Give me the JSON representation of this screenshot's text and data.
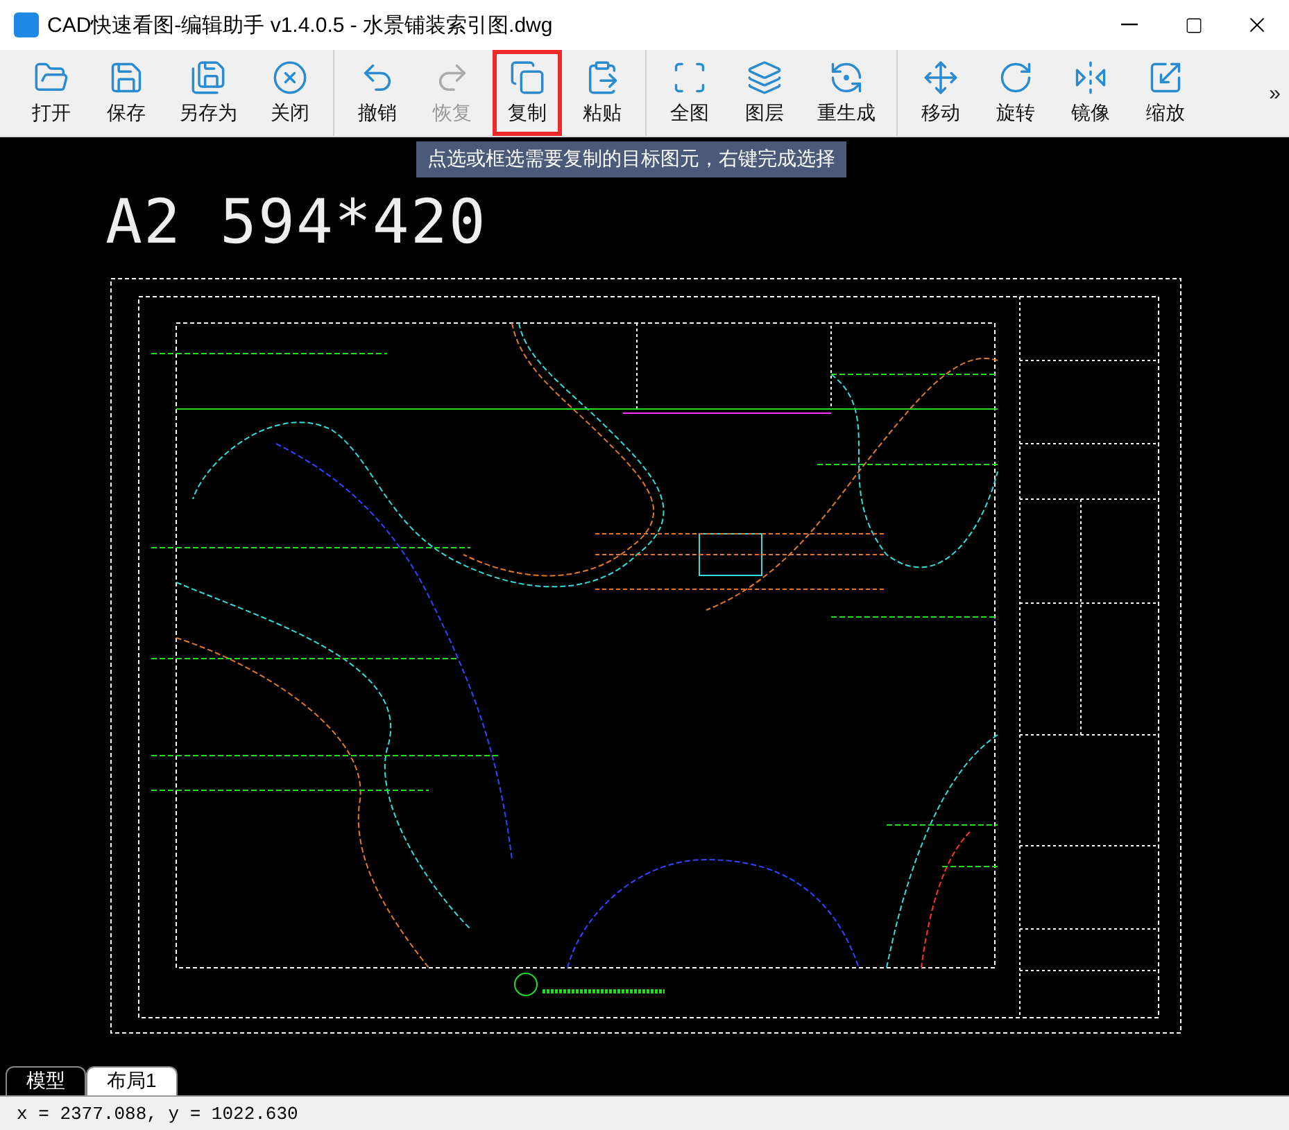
{
  "window": {
    "title": "CAD快速看图-编辑助手 v1.4.0.5 - 水景铺装索引图.dwg"
  },
  "toolbar": {
    "groups": [
      [
        {
          "label": "打开",
          "disabled": false,
          "highlighted": false
        },
        {
          "label": "保存",
          "disabled": false,
          "highlighted": false
        },
        {
          "label": "另存为",
          "disabled": false,
          "highlighted": false
        },
        {
          "label": "关闭",
          "disabled": false,
          "highlighted": false
        }
      ],
      [
        {
          "label": "撤销",
          "disabled": false,
          "highlighted": false
        },
        {
          "label": "恢复",
          "disabled": true,
          "highlighted": false
        },
        {
          "label": "复制",
          "disabled": false,
          "highlighted": true
        },
        {
          "label": "粘贴",
          "disabled": false,
          "highlighted": false
        }
      ],
      [
        {
          "label": "全图",
          "disabled": false,
          "highlighted": false
        },
        {
          "label": "图层",
          "disabled": false,
          "highlighted": false
        },
        {
          "label": "重生成",
          "disabled": false,
          "highlighted": false
        }
      ],
      [
        {
          "label": "移动",
          "disabled": false,
          "highlighted": false
        },
        {
          "label": "旋转",
          "disabled": false,
          "highlighted": false
        },
        {
          "label": "镜像",
          "disabled": false,
          "highlighted": false
        },
        {
          "label": "缩放",
          "disabled": false,
          "highlighted": false
        }
      ]
    ],
    "overflow": "»"
  },
  "tooltip": "点选或框选需要复制的目标图元，右键完成选择",
  "canvas": {
    "sheet_label": "A2 594*420"
  },
  "layout_tabs": [
    {
      "label": "模型",
      "selected": true
    },
    {
      "label": "布局1",
      "selected": false
    }
  ],
  "status_bar": {
    "coordinates": "x = 2377.088, y = 1022.630"
  }
}
